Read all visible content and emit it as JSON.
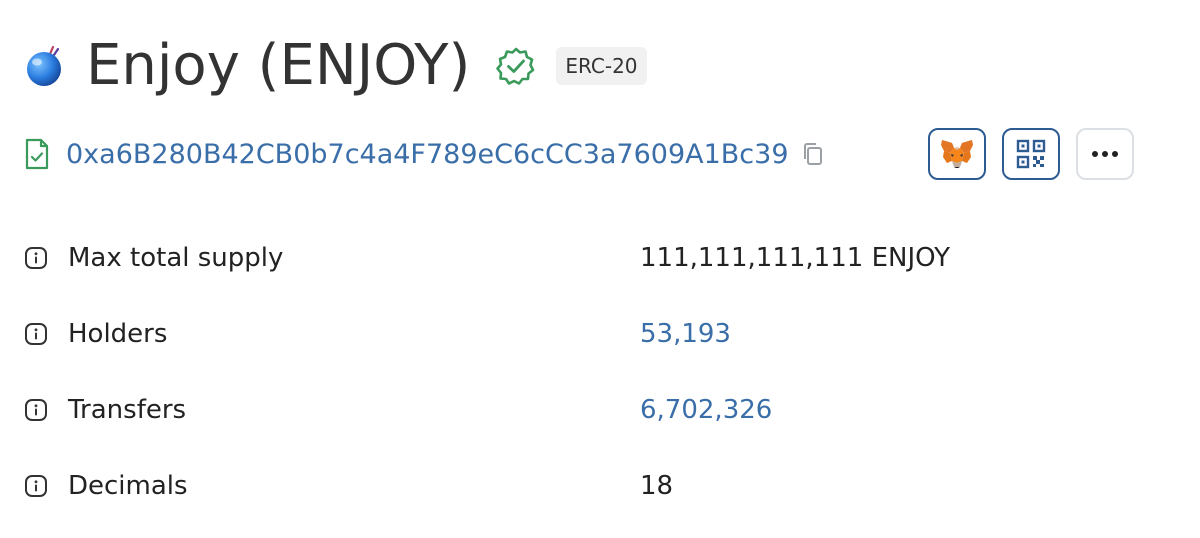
{
  "token": {
    "name": "Enjoy (ENJOY)",
    "standard": "ERC-20",
    "contract_address": "0xa6B280B42CB0b7c4a4F789eC6cCC3a7609A1Bc39"
  },
  "icons": {
    "logo": "token-logo-icon",
    "verified": "verified-badge-icon",
    "contract": "contract-file-icon",
    "copy": "copy-icon",
    "metamask": "metamask-fox-icon",
    "qr": "qr-code-icon",
    "more": "more-dots-icon",
    "info": "info-icon"
  },
  "colors": {
    "link": "#3a6ea8",
    "verified": "#3a9a5b",
    "button_border": "#2f5b93",
    "tag_background": "#f1f1f1"
  },
  "details": [
    {
      "label": "Max total supply",
      "value": "111,111,111,111 ENJOY",
      "is_link": false
    },
    {
      "label": "Holders",
      "value": "53,193",
      "is_link": true
    },
    {
      "label": "Transfers",
      "value": "6,702,326",
      "is_link": true
    },
    {
      "label": "Decimals",
      "value": "18",
      "is_link": false
    }
  ]
}
